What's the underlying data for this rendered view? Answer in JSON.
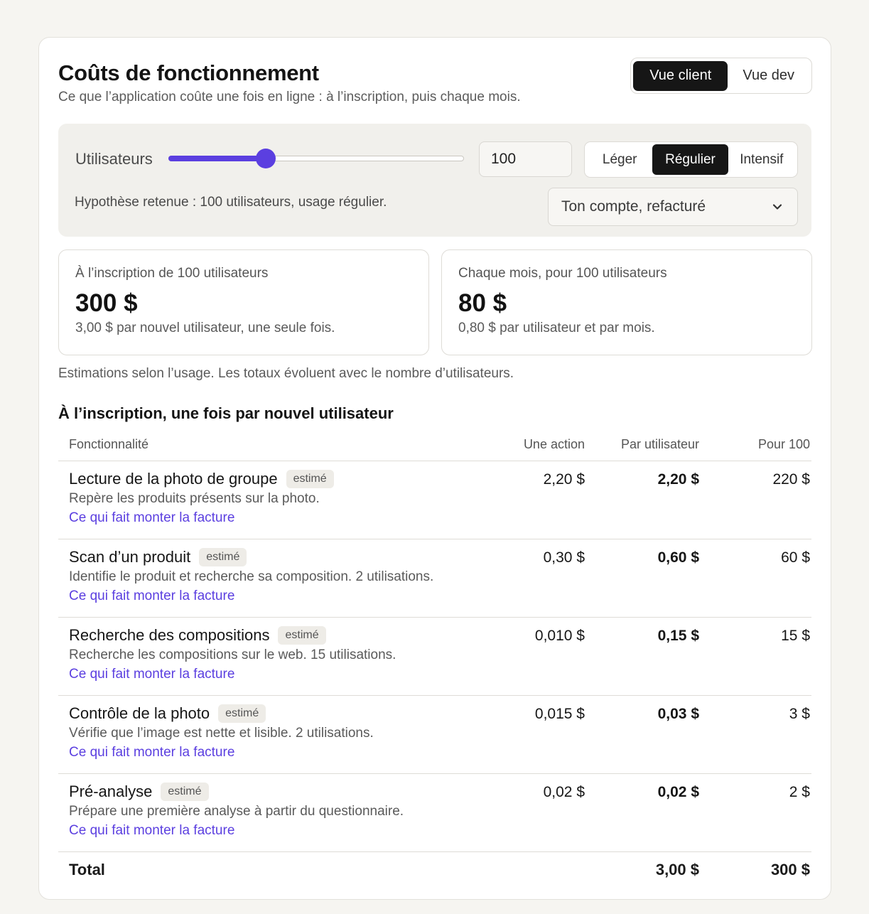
{
  "header": {
    "title": "Coûts de fonctionnement",
    "subtitle": "Ce que l’application coûte une fois en ligne : à l’inscription, puis chaque mois.",
    "view_client": "Vue client",
    "view_dev": "Vue dev"
  },
  "controls": {
    "users_label": "Utilisateurs",
    "slider_fraction": 0.33,
    "users_value": "100",
    "intensity": [
      "Léger",
      "Régulier",
      "Intensif"
    ],
    "hypothese": "Hypothèse retenue : 100 utilisateurs, usage régulier.",
    "billing_select": "Ton compte, refacturé"
  },
  "summary": {
    "signup": {
      "caption": "À l’inscription de 100 utilisateurs",
      "amount": "300 $",
      "note": "3,00 $ par nouvel utilisateur, une seule fois."
    },
    "monthly": {
      "caption": "Chaque mois, pour 100 utilisateurs",
      "amount": "80 $",
      "note": "0,80 $ par utilisateur et par mois."
    },
    "estimation_note": "Estimations selon l’usage. Les totaux évoluent avec le nombre d’utilisateurs."
  },
  "table": {
    "section_title": "À l’inscription, une fois par nouvel utilisateur",
    "headers": {
      "feature": "Fonctionnalité",
      "per_action": "Une action",
      "per_user": "Par utilisateur",
      "per_100": "Pour 100"
    },
    "badge": "estimé",
    "link": "Ce qui fait monter la facture",
    "rows": [
      {
        "name": "Lecture de la photo de groupe",
        "desc": "Repère les produits présents sur la photo.",
        "action": "2,20 $",
        "user": "2,20 $",
        "hundred": "220 $"
      },
      {
        "name": "Scan d’un produit",
        "desc": "Identifie le produit et recherche sa composition. 2 utilisations.",
        "action": "0,30 $",
        "user": "0,60 $",
        "hundred": "60 $"
      },
      {
        "name": "Recherche des compositions",
        "desc": "Recherche les compositions sur le web. 15 utilisations.",
        "action": "0,010 $",
        "user": "0,15 $",
        "hundred": "15 $"
      },
      {
        "name": "Contrôle de la photo",
        "desc": "Vérifie que l’image est nette et lisible. 2 utilisations.",
        "action": "0,015 $",
        "user": "0,03 $",
        "hundred": "3 $"
      },
      {
        "name": "Pré-analyse",
        "desc": "Prépare une première analyse à partir du questionnaire.",
        "action": "0,02 $",
        "user": "0,02 $",
        "hundred": "2 $"
      }
    ],
    "total": {
      "label": "Total",
      "user": "3,00 $",
      "hundred": "300 $"
    }
  },
  "colors": {
    "accent": "#5b3fe0",
    "active_segment": "#161616",
    "background": "#f6f5f1"
  }
}
